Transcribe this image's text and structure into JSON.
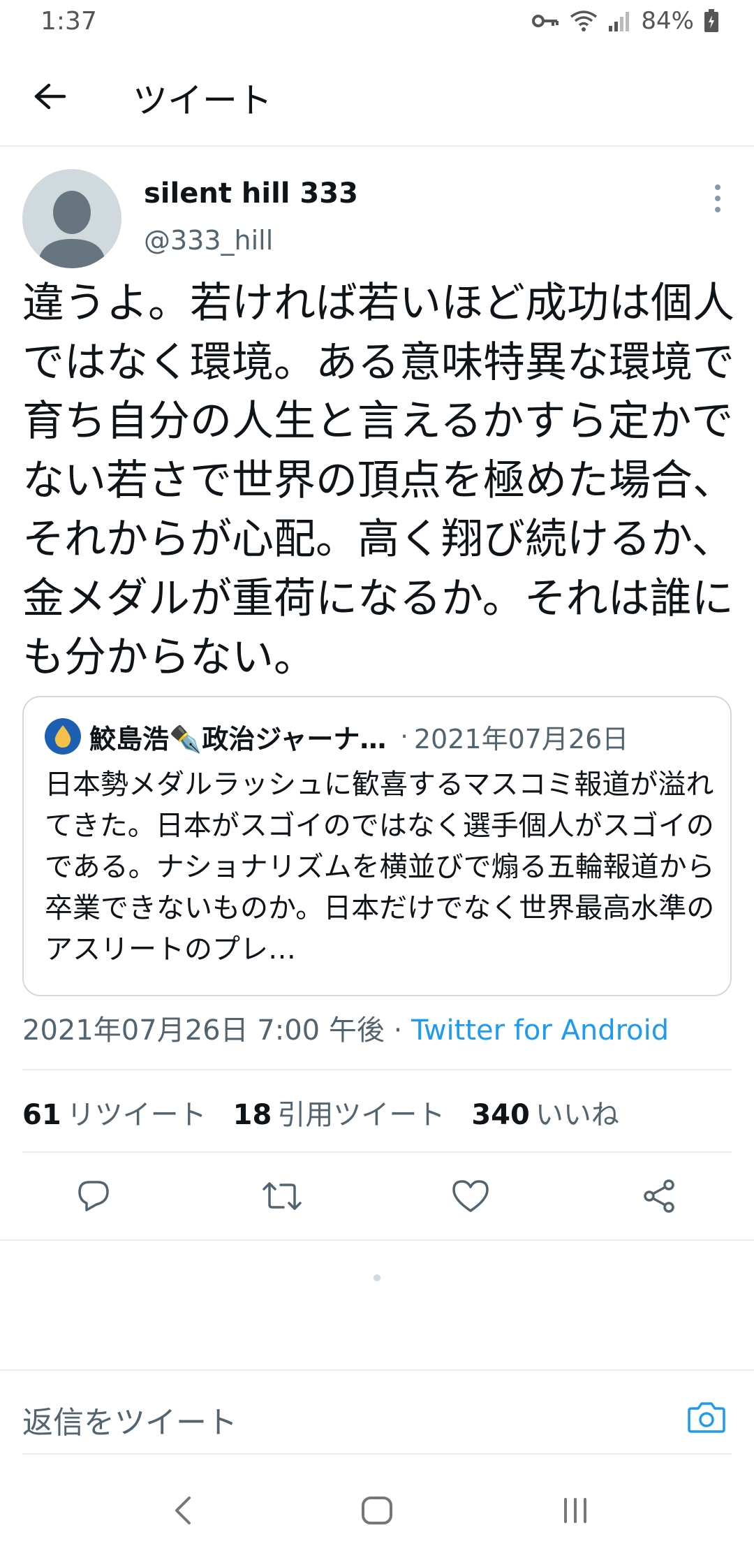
{
  "status_bar": {
    "time": "1:37",
    "battery": "84%"
  },
  "app_bar": {
    "title": "ツイート"
  },
  "tweet": {
    "author_name": "silent hill 333",
    "author_handle": "@333_hill",
    "text": "違うよ。若ければ若いほど成功は個人ではなく環境。ある意味特異な環境で育ち自分の人生と言えるかすら定かでない若さで世界の頂点を極めた場合、それからが心配。高く翔び続けるか、金メダルが重荷になるか。それは誰にも分からない。",
    "timestamp": "2021年07月26日 7:00 午後",
    "separator": " · ",
    "source": "Twitter for Android"
  },
  "quoted_tweet": {
    "author_name": "鮫島浩✒️政治ジャーナ…",
    "dot": "·",
    "date": "2021年07月26日",
    "text": "日本勢メダルラッシュに歓喜するマスコミ報道が溢れてきた。日本がスゴイのではなく選手個人がスゴイのである。ナショナリズムを横並びで煽る五輪報道から卒業できないものか。日本だけでなく世界最高水準のアスリートのプレ…"
  },
  "stats": {
    "retweets": {
      "count": "61",
      "label": "リツイート"
    },
    "quotes": {
      "count": "18",
      "label": "引用ツイート"
    },
    "likes": {
      "count": "340",
      "label": "いいね"
    }
  },
  "reply": {
    "placeholder": "返信をツイート"
  },
  "colors": {
    "link": "#1d9bf0",
    "secondary_text": "#536471",
    "divider": "#e6ecf0"
  },
  "icons": [
    "back-arrow-icon",
    "more-vertical-icon",
    "reply-icon",
    "retweet-icon",
    "like-icon",
    "share-icon",
    "camera-icon",
    "nav-back-icon",
    "nav-home-icon",
    "nav-recents-icon"
  ]
}
